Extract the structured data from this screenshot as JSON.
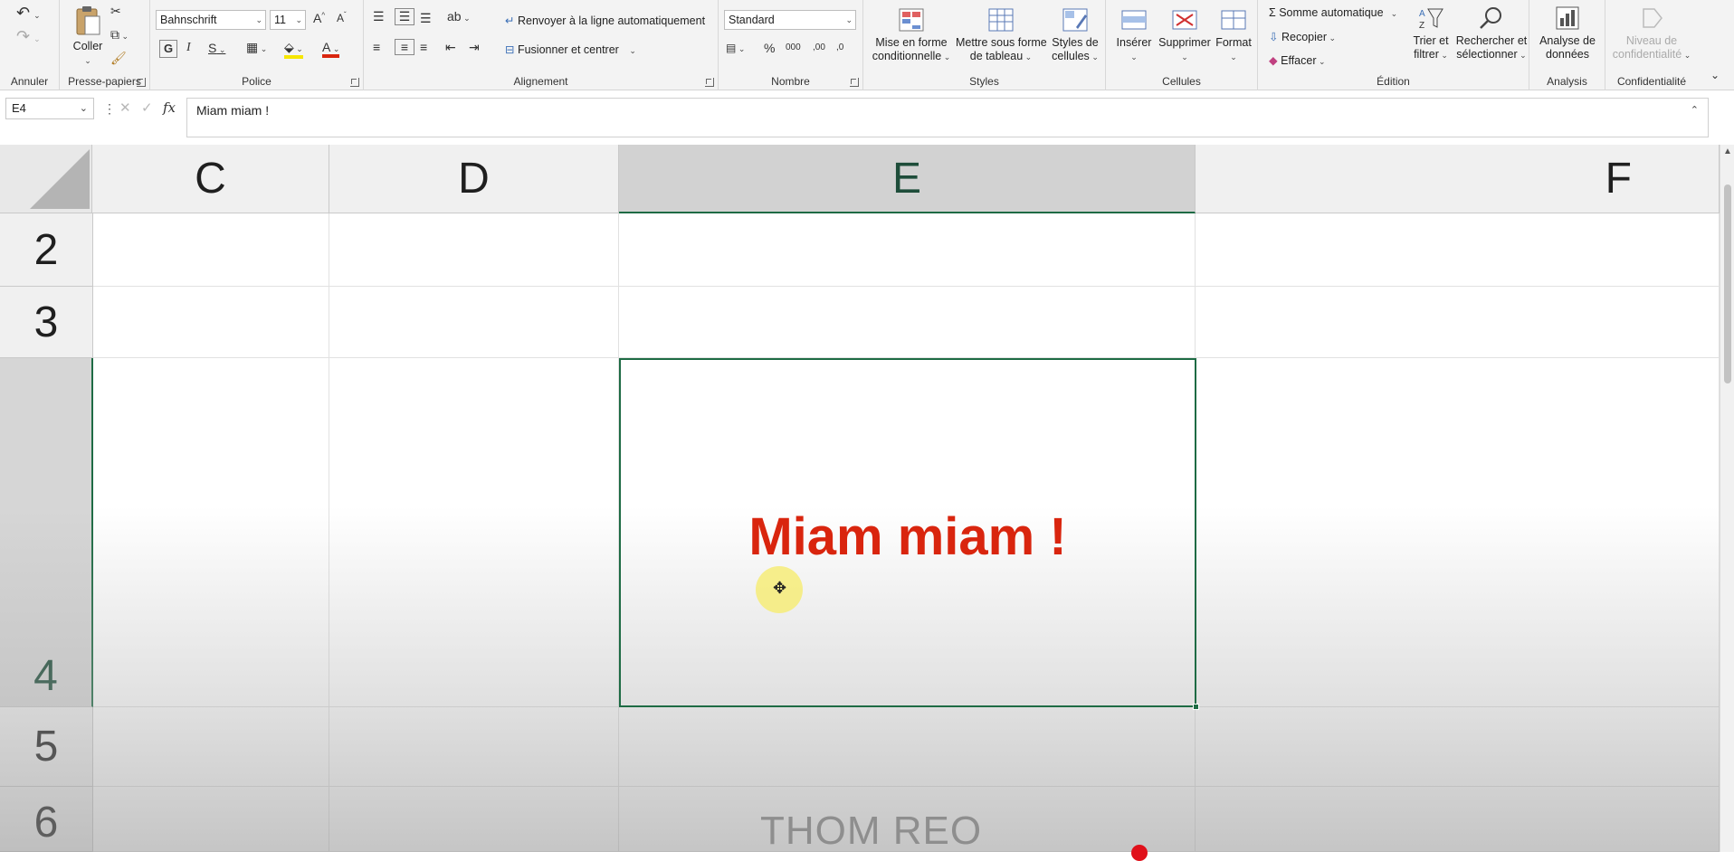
{
  "ribbon": {
    "undo": {
      "label": "Annuler"
    },
    "clipboard": {
      "group": "Presse-papiers",
      "paste": "Coller"
    },
    "font": {
      "group": "Police",
      "family": "Bahnschrift",
      "size": "11",
      "bold": "G",
      "italic": "I",
      "underline": "S"
    },
    "alignment": {
      "group": "Alignement",
      "wrap": "Renvoyer à la ligne automatiquement",
      "merge": "Fusionner et centrer"
    },
    "number": {
      "group": "Nombre",
      "format": "Standard",
      "percent": "%",
      "thousands": "000",
      "inc_decimals": ",00",
      "dec_decimals": ",0"
    },
    "styles": {
      "group": "Styles",
      "conditional": [
        "Mise en forme",
        "conditionnelle"
      ],
      "as_table": [
        "Mettre sous forme",
        "de tableau"
      ],
      "cell_styles": [
        "Styles de",
        "cellules"
      ]
    },
    "cells": {
      "group": "Cellules",
      "insert": "Insérer",
      "delete": "Supprimer",
      "format": "Format"
    },
    "editing": {
      "group": "Édition",
      "autosum": "Somme automatique",
      "fill": "Recopier",
      "clear": "Effacer",
      "sort": [
        "Trier et",
        "filtrer"
      ],
      "find": [
        "Rechercher et",
        "sélectionner"
      ]
    },
    "analysis": {
      "group": "Analysis",
      "analyze": [
        "Analyse de",
        "données"
      ]
    },
    "sensitivity": {
      "group": "Confidentialité",
      "level": [
        "Niveau de",
        "confidentialité"
      ]
    }
  },
  "formula_bar": {
    "name_box": "E4",
    "fx": "fx",
    "content": "Miam miam !"
  },
  "sheet": {
    "columns": [
      "C",
      "D",
      "E",
      "F"
    ],
    "selected_column": "E",
    "rows": [
      "2",
      "3",
      "4",
      "5",
      "6"
    ],
    "selected_row": "4",
    "active_cell_text": "Miam miam !",
    "active_cell_color": "#d9250e"
  },
  "overlay": {
    "watermark": "THOM REO"
  },
  "colors": {
    "selection": "#1e6b44",
    "cursor_highlight": "#f6ec78"
  }
}
